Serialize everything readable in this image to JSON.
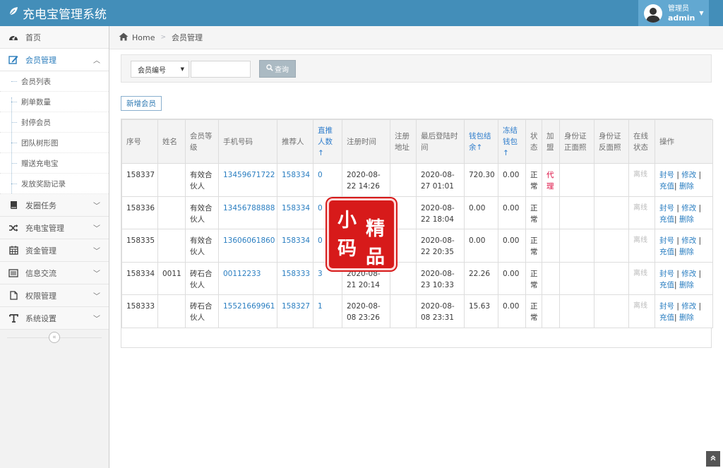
{
  "app": {
    "title": "充电宝管理系统"
  },
  "user": {
    "role": "管理员",
    "name": "admin"
  },
  "breadcrumb": {
    "home": "Home",
    "current": "会员管理"
  },
  "sidebar": {
    "items": [
      {
        "label": "首页",
        "icon": "dashboard-icon"
      },
      {
        "label": "会员管理",
        "icon": "edit-icon",
        "active": true
      },
      {
        "label": "发圈任务",
        "icon": "book-icon"
      },
      {
        "label": "充电宝管理",
        "icon": "random-icon"
      },
      {
        "label": "资金管理",
        "icon": "calendar-icon"
      },
      {
        "label": "信息交流",
        "icon": "list-icon"
      },
      {
        "label": "权限管理",
        "icon": "file-icon"
      },
      {
        "label": "系统设置",
        "icon": "text-icon"
      }
    ],
    "submenu": [
      "会员列表",
      "刷单数量",
      "封停会员",
      "团队树形图",
      "赠送充电宝",
      "发放奖励记录"
    ]
  },
  "search": {
    "field_selected": "会员编号",
    "input_value": "",
    "button_label": "查询"
  },
  "actions": {
    "add_member": "新增会员"
  },
  "table": {
    "headers": [
      "序号",
      "姓名",
      "会员等级",
      "手机号码",
      "推荐人",
      "直推人数↑",
      "注册时间",
      "注册地址",
      "最后登陆时间",
      "钱包结余↑",
      "冻结钱包↑",
      "状态",
      "加盟",
      "身份证正面照",
      "身份证反面照",
      "在线状态",
      "操作"
    ],
    "rows": [
      {
        "id": "158337",
        "name": "",
        "level": "有效合伙人",
        "phone": "13459671722",
        "referrer": "158334",
        "direct": "0",
        "reg_time": "2020-08-22 14:26",
        "reg_addr": "",
        "last_login": "2020-08-27 01:01",
        "wallet": "720.30",
        "frozen": "0.00",
        "status": "正常",
        "join": "代理",
        "id_front": "",
        "id_back": "",
        "online": "离线"
      },
      {
        "id": "158336",
        "name": "",
        "level": "有效合伙人",
        "phone": "13456788888",
        "referrer": "158334",
        "direct": "0",
        "reg_time": "",
        "reg_addr": "",
        "last_login": "2020-08-22 18:04",
        "wallet": "0.00",
        "frozen": "0.00",
        "status": "正常",
        "join": "",
        "id_front": "",
        "id_back": "",
        "online": "离线"
      },
      {
        "id": "158335",
        "name": "",
        "level": "有效合伙人",
        "phone": "13606061860",
        "referrer": "158334",
        "direct": "0",
        "reg_time": "",
        "reg_addr": "",
        "last_login": "2020-08-22 20:35",
        "wallet": "0.00",
        "frozen": "0.00",
        "status": "正常",
        "join": "",
        "id_front": "",
        "id_back": "",
        "online": "离线"
      },
      {
        "id": "158334",
        "name": "0011",
        "level": "砖石合伙人",
        "phone": "00112233",
        "referrer": "158333",
        "direct": "3",
        "reg_time": "2020-08-21 20:14",
        "reg_addr": "",
        "last_login": "2020-08-23 10:33",
        "wallet": "22.26",
        "frozen": "0.00",
        "status": "正常",
        "join": "",
        "id_front": "",
        "id_back": "",
        "online": "离线"
      },
      {
        "id": "158333",
        "name": "",
        "level": "砖石合伙人",
        "phone": "15521669961",
        "referrer": "158327",
        "direct": "1",
        "reg_time": "2020-08-08 23:26",
        "reg_addr": "",
        "last_login": "2020-08-08 23:31",
        "wallet": "15.63",
        "frozen": "0.00",
        "status": "正常",
        "join": "",
        "id_front": "",
        "id_back": "",
        "online": "离线"
      }
    ],
    "ops": {
      "ban": "封号",
      "edit": "修改",
      "recharge": "充值",
      "delete": "删除"
    }
  },
  "watermark": {
    "chars": [
      "小",
      "精",
      "码",
      "品"
    ]
  },
  "colors": {
    "topbar": "#438eb9",
    "link": "#2a7ec1",
    "accent_red": "#d71a1a"
  }
}
